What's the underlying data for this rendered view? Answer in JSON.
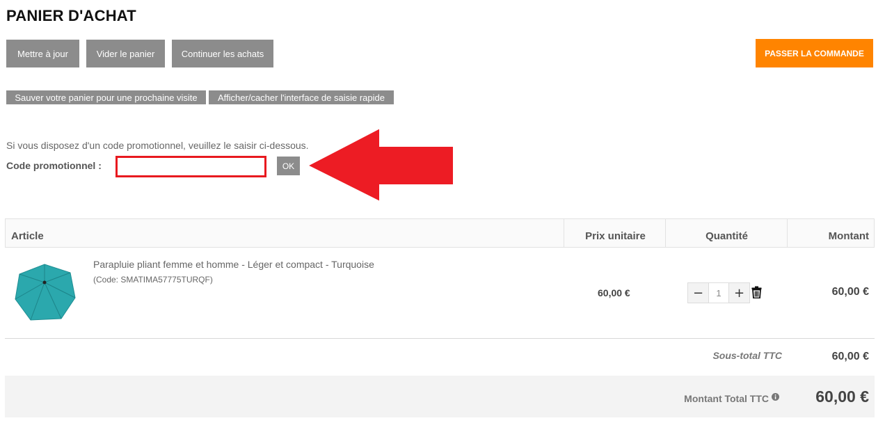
{
  "page": {
    "title": "PANIER D'ACHAT"
  },
  "toolbar": {
    "update_label": "Mettre à jour",
    "empty_label": "Vider le panier",
    "continue_label": "Continuer les achats",
    "checkout_label": "PASSER LA COMMANDE",
    "save_cart_label": "Sauver votre panier pour une prochaine visite",
    "quick_entry_label": "Afficher/cacher l'interface de saisie rapide"
  },
  "promo": {
    "note": "Si vous disposez d'un code promotionnel, veuillez le saisir ci-dessous.",
    "label": "Code promotionnel :",
    "value": "",
    "ok_label": "OK"
  },
  "table": {
    "headers": {
      "article": "Article",
      "unit_price": "Prix unitaire",
      "quantity": "Quantité",
      "amount": "Montant"
    },
    "rows": [
      {
        "name": "Parapluie pliant femme et homme - Léger et compact - Turquoise",
        "code": "(Code: SMATIMA57775TURQF)",
        "unit_price": "60,00 €",
        "quantity": "1",
        "amount": "60,00 €"
      }
    ]
  },
  "totals": {
    "subtotal_label": "Sous-total TTC",
    "subtotal_value": "60,00 €",
    "total_label": "Montant Total TTC",
    "total_value": "60,00 €"
  },
  "icons": {
    "minus": "minus-icon",
    "plus": "plus-icon",
    "delete": "trash-icon",
    "info": "info-icon",
    "annotation": "red-arrow-left"
  },
  "colors": {
    "accent": "#ff8400",
    "button_grey": "#8c8c8c",
    "highlight_red": "#e8191f",
    "product_turquoise": "#2ba8ad"
  }
}
